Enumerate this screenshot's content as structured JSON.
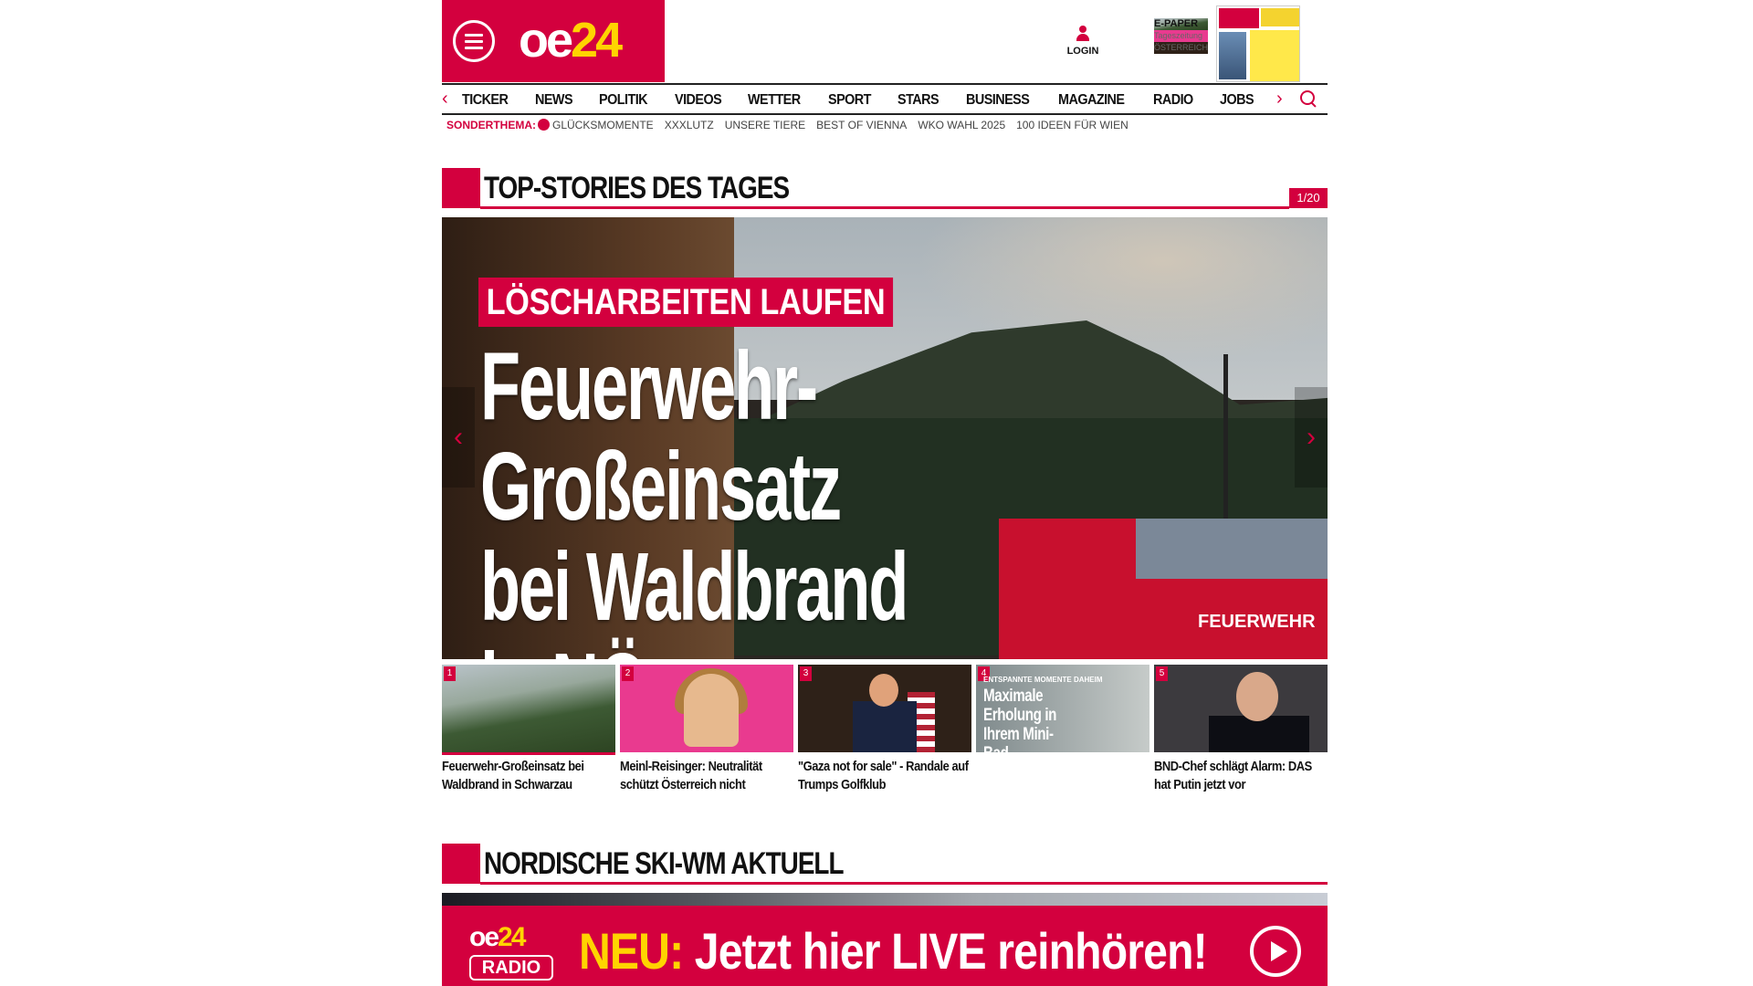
{
  "header": {
    "logo_oe": "oe",
    "logo_num": "24",
    "login_label": "LOGIN",
    "epaper_title": "E-PAPER",
    "epaper_line2": "Tageszeitung",
    "epaper_line3": "ÖSTERREICH"
  },
  "nav": {
    "items": [
      "TICKER",
      "NEWS",
      "POLITIK",
      "VIDEOS",
      "WETTER",
      "SPORT",
      "STARS",
      "BUSINESS",
      "MAGAZINE",
      "RADIO",
      "JOBS"
    ]
  },
  "subnav": {
    "label": "SONDERTHEMA:",
    "items": [
      "GLÜCKSMOMENTE",
      "XXXLUTZ",
      "UNSERE TIERE",
      "BEST OF VIENNA",
      "WKO WAHL 2025",
      "100 IDEEN FÜR WIEN"
    ]
  },
  "top_stories": {
    "title": "TOP-STORIES DES TAGES",
    "counter": "1/20",
    "hero": {
      "kicker": "LÖSCHARBEITEN LAUFEN",
      "headline": "Feuerwehr-Großeinsatz bei Waldbrand in NÖ",
      "truck_label": "FEUERWEHR"
    },
    "thumbs": [
      {
        "num": "1",
        "caption": "Feuerwehr-Großeinsatz bei Waldbrand in Schwarzau"
      },
      {
        "num": "2",
        "caption": "Meinl-Reisinger: Neutralität schützt Österreich nicht"
      },
      {
        "num": "3",
        "caption": "\"Gaza not for sale\" - Randale auf Trumps Golfklub"
      },
      {
        "num": "4",
        "caption": "",
        "ad_kicker": "ENTSPANNTE MOMENTE DAHEIM",
        "ad_title": "Maximale Erholung in Ihrem Mini-Bad"
      },
      {
        "num": "5",
        "caption": "BND-Chef schlägt Alarm: DAS hat Putin jetzt vor"
      }
    ]
  },
  "ski_section": {
    "title": "NORDISCHE SKI-WM AKTUELL"
  },
  "radio_banner": {
    "logo_oe": "oe",
    "logo_num": "24",
    "badge": "RADIO",
    "neu": "NEU:",
    "cta": "Jetzt hier LIVE reinhören!"
  },
  "colors": {
    "brand_red": "#d3003e",
    "accent_yellow": "#ffd400"
  }
}
